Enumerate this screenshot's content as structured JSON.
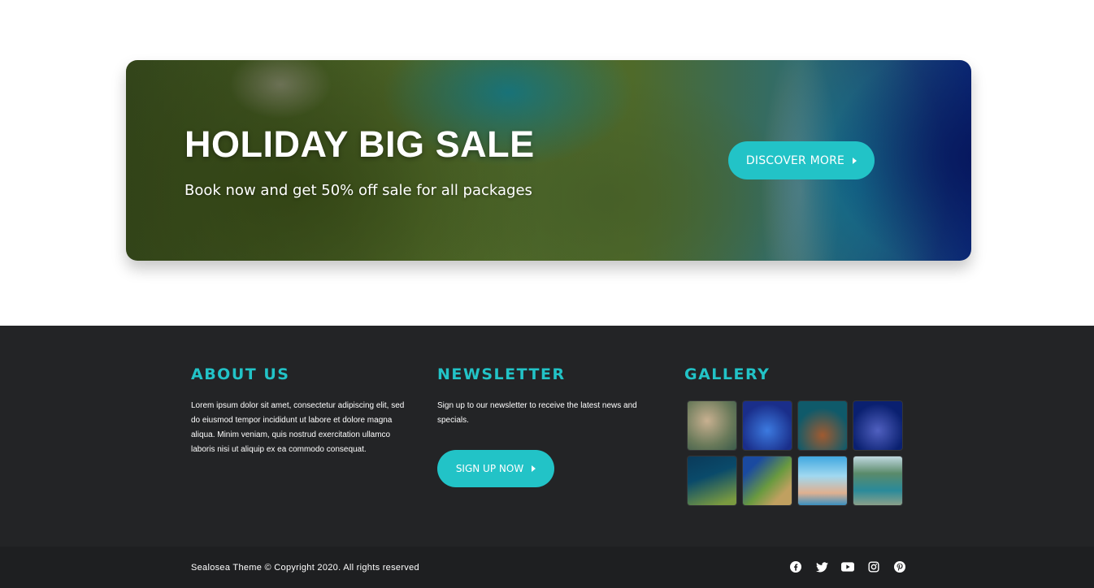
{
  "banner": {
    "title": "HOLIDAY BIG SALE",
    "subtitle": "Book now and get 50% off sale for all packages",
    "cta_label": "DISCOVER MORE"
  },
  "footer": {
    "about": {
      "title": "ABOUT US",
      "text": "Lorem ipsum dolor sit amet, consectetur adipiscing elit, sed do eiusmod tempor incididunt ut labore et dolore magna aliqua. Minim veniam, quis nostrud exercitation ullamco laboris nisi ut aliquip ex ea commodo consequat."
    },
    "newsletter": {
      "title": "NEWSLETTER",
      "text": "Sign up to our newsletter to receive the latest news and specials.",
      "button_label": "SIGN UP NOW"
    },
    "gallery": {
      "title": "GALLERY"
    }
  },
  "bottom_bar": {
    "copyright": "Sealosea Theme © Copyright 2020. All rights reserved",
    "social_icons": [
      "facebook-icon",
      "twitter-icon",
      "youtube-icon",
      "instagram-icon",
      "pinterest-icon"
    ]
  },
  "colors": {
    "accent": "#22c3c7",
    "footer_bg": "#232426",
    "bottom_bar_bg": "#1e1f21"
  }
}
